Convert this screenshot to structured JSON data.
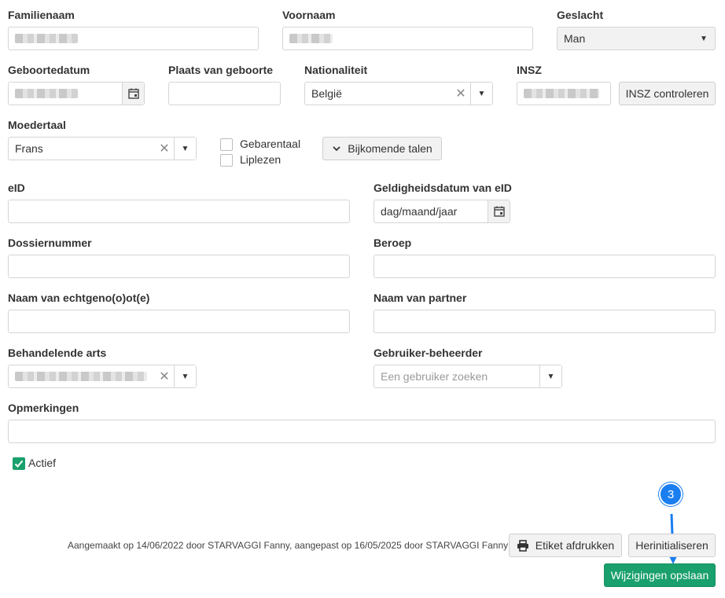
{
  "labels": {
    "familienaam": "Familienaam",
    "voornaam": "Voornaam",
    "geslacht": "Geslacht",
    "geboortedatum": "Geboortedatum",
    "plaats": "Plaats van geboorte",
    "nationaliteit": "Nationaliteit",
    "insz": "INSZ",
    "moedertaal": "Moedertaal",
    "eid": "eID",
    "geldigheid": "Geldigheidsdatum van eID",
    "dossier": "Dossiernummer",
    "beroep": "Beroep",
    "echtgenoot": "Naam van echtgeno(o)ot(e)",
    "partner": "Naam van partner",
    "arts": "Behandelende arts",
    "beheerder": "Gebruiker-beheerder",
    "opmerkingen": "Opmerkingen"
  },
  "values": {
    "geslacht": "Man",
    "nationaliteit": "België",
    "moedertaal": "Frans"
  },
  "placeholders": {
    "geldigheid": "dag/maand/jaar",
    "beheerder": "Een gebruiker zoeken"
  },
  "checkboxes": {
    "gebarentaal": "Gebarentaal",
    "liplezen": "Liplezen",
    "actief": "Actief"
  },
  "buttons": {
    "insz_check": "INSZ controleren",
    "bijkomende": "Bijkomende talen",
    "etiket": "Etiket afdrukken",
    "herinit": "Herinitialiseren",
    "opslaan": "Wijzigingen opslaan"
  },
  "footer": {
    "audit": "Aangemaakt op 14/06/2022 door STARVAGGI Fanny, aangepast op 16/05/2025 door STARVAGGI Fanny"
  },
  "annotation": {
    "step": "3"
  },
  "colors": {
    "primary": "#1aa06d",
    "annotation": "#1a7ef0"
  }
}
